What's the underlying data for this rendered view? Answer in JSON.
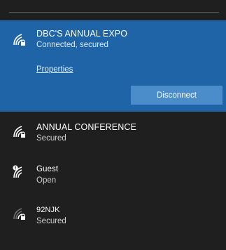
{
  "networks": [
    {
      "name": "DBC'S ANNUAL EXPO",
      "status": "Connected, secured",
      "properties_label": "Properties",
      "action_label": "Disconnect",
      "icon": "wifi-secured-icon"
    },
    {
      "name": "ANNUAL CONFERENCE",
      "status": "Secured",
      "icon": "wifi-secured-icon"
    },
    {
      "name": "Guest",
      "status": "Open",
      "icon": "wifi-open-warning-icon"
    },
    {
      "name": "92NJK",
      "status": "Secured",
      "icon": "wifi-weak-icon"
    }
  ],
  "colors": {
    "background": "#1f1f1f",
    "active_bg": "#1e64a6",
    "button_bg": "#4b8cca"
  }
}
